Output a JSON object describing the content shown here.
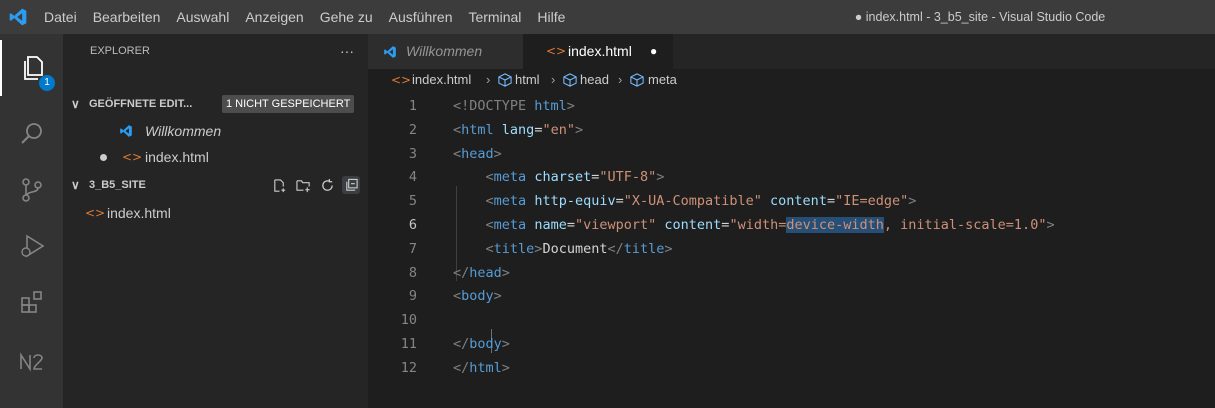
{
  "titlebar": {
    "menu": [
      "Datei",
      "Bearbeiten",
      "Auswahl",
      "Anzeigen",
      "Gehe zu",
      "Ausführen",
      "Terminal",
      "Hilfe"
    ],
    "window_title": "● index.html - 3_b5_site - Visual Studio Code"
  },
  "activity_bar": {
    "items": [
      "files-icon",
      "search-icon",
      "source-control-icon",
      "run-debug-icon",
      "extensions-icon",
      "n2-icon"
    ],
    "explorer_badge": "1"
  },
  "sidebar": {
    "header": "EXPLORER",
    "more": "···",
    "open_editors": {
      "title": "GEÖFFNETE EDIT...",
      "unsaved_badge": "1 NICHT GESPEICHERT",
      "items": [
        {
          "label": "Willkommen"
        },
        {
          "label": "index.html"
        }
      ]
    },
    "workspace": {
      "title": "3_B5_SITE",
      "files": [
        "index.html"
      ]
    }
  },
  "tabs": [
    {
      "label": "Willkommen"
    },
    {
      "label": "index.html",
      "dirty_marker": "●"
    }
  ],
  "breadcrumb": [
    "index.html",
    "html",
    "head",
    "meta"
  ],
  "editor": {
    "current_line": 6,
    "lines": [
      {
        "n": "1",
        "tokens": [
          [
            "br",
            "<!DOCTYPE "
          ],
          [
            "tag",
            "html"
          ],
          [
            "br",
            ">"
          ]
        ]
      },
      {
        "n": "2",
        "tokens": [
          [
            "br",
            "<"
          ],
          [
            "tag",
            "html"
          ],
          [
            "txt",
            " "
          ],
          [
            "attr",
            "lang"
          ],
          [
            "txt",
            "="
          ],
          [
            "val",
            "\"en\""
          ],
          [
            "br",
            ">"
          ]
        ]
      },
      {
        "n": "3",
        "tokens": [
          [
            "br",
            "<"
          ],
          [
            "tag",
            "head"
          ],
          [
            "br",
            ">"
          ]
        ]
      },
      {
        "n": "4",
        "tokens": [
          [
            "txt",
            "    "
          ],
          [
            "br",
            "<"
          ],
          [
            "tag",
            "meta"
          ],
          [
            "txt",
            " "
          ],
          [
            "attr",
            "charset"
          ],
          [
            "txt",
            "="
          ],
          [
            "val",
            "\"UTF-8\""
          ],
          [
            "br",
            ">"
          ]
        ]
      },
      {
        "n": "5",
        "tokens": [
          [
            "txt",
            "    "
          ],
          [
            "br",
            "<"
          ],
          [
            "tag",
            "meta"
          ],
          [
            "txt",
            " "
          ],
          [
            "attr",
            "http-equiv"
          ],
          [
            "txt",
            "="
          ],
          [
            "val",
            "\"X-UA-Compatible\""
          ],
          [
            "txt",
            " "
          ],
          [
            "attr",
            "content"
          ],
          [
            "txt",
            "="
          ],
          [
            "val",
            "\"IE=edge\""
          ],
          [
            "br",
            ">"
          ]
        ]
      },
      {
        "n": "6",
        "tokens": [
          [
            "txt",
            "    "
          ],
          [
            "br",
            "<"
          ],
          [
            "tag",
            "meta"
          ],
          [
            "txt",
            " "
          ],
          [
            "attr",
            "name"
          ],
          [
            "txt",
            "="
          ],
          [
            "val",
            "\"viewport\""
          ],
          [
            "txt",
            " "
          ],
          [
            "attr",
            "content"
          ],
          [
            "txt",
            "="
          ],
          [
            "val",
            "\"width="
          ],
          [
            "valhl",
            "device-width"
          ],
          [
            "val",
            ", initial-scale=1.0\""
          ],
          [
            "br",
            ">"
          ]
        ]
      },
      {
        "n": "7",
        "tokens": [
          [
            "txt",
            "    "
          ],
          [
            "br",
            "<"
          ],
          [
            "tag",
            "title"
          ],
          [
            "br",
            ">"
          ],
          [
            "txt",
            "Document"
          ],
          [
            "br",
            "</"
          ],
          [
            "tag",
            "title"
          ],
          [
            "br",
            ">"
          ]
        ]
      },
      {
        "n": "8",
        "tokens": [
          [
            "br",
            "</"
          ],
          [
            "tag",
            "head"
          ],
          [
            "br",
            ">"
          ]
        ]
      },
      {
        "n": "9",
        "tokens": [
          [
            "br",
            "<"
          ],
          [
            "tag",
            "body"
          ],
          [
            "br",
            ">"
          ]
        ]
      },
      {
        "n": "10",
        "tokens": [
          [
            "txt",
            "    "
          ]
        ]
      },
      {
        "n": "11",
        "tokens": [
          [
            "br",
            "</"
          ],
          [
            "tag",
            "body"
          ],
          [
            "br",
            ">"
          ]
        ]
      },
      {
        "n": "12",
        "tokens": [
          [
            "br",
            "</"
          ],
          [
            "tag",
            "html"
          ],
          [
            "br",
            ">"
          ]
        ]
      }
    ]
  },
  "colors": {
    "accent": "#007acc",
    "html_icon": "#e37933",
    "selection": "#264f78"
  }
}
